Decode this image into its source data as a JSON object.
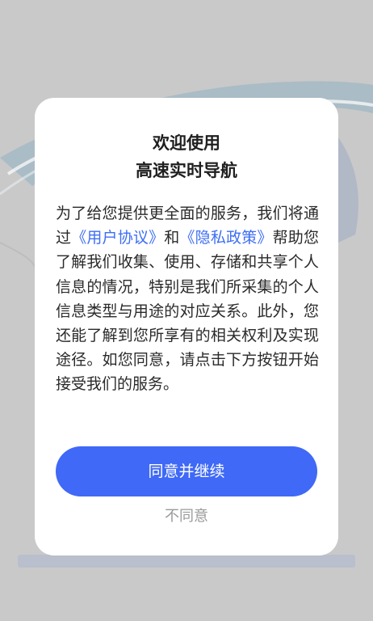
{
  "dialog": {
    "title_line1": "欢迎使用",
    "title_line2": "高速实时导航",
    "body": {
      "part1": "为了给您提供更全面的服务，我们将通过",
      "link_user_agreement": "《用户协议》",
      "conj": "和",
      "link_privacy_policy": "《隐私政策》",
      "part2": "帮助您了解我们收集、使用、存储和共享个人信息的情况，特别是我们所采集的个人信息类型与用途的对应关系。此外，您还能了解到您所享有的相关权利及实现途径。如您同意，请点击下方按钮开始接受我们的服务。"
    },
    "agree_label": "同意并继续",
    "disagree_label": "不同意"
  },
  "colors": {
    "accent": "#3f69f6",
    "link": "#3d6ef5",
    "background": "#c9c9c9"
  }
}
